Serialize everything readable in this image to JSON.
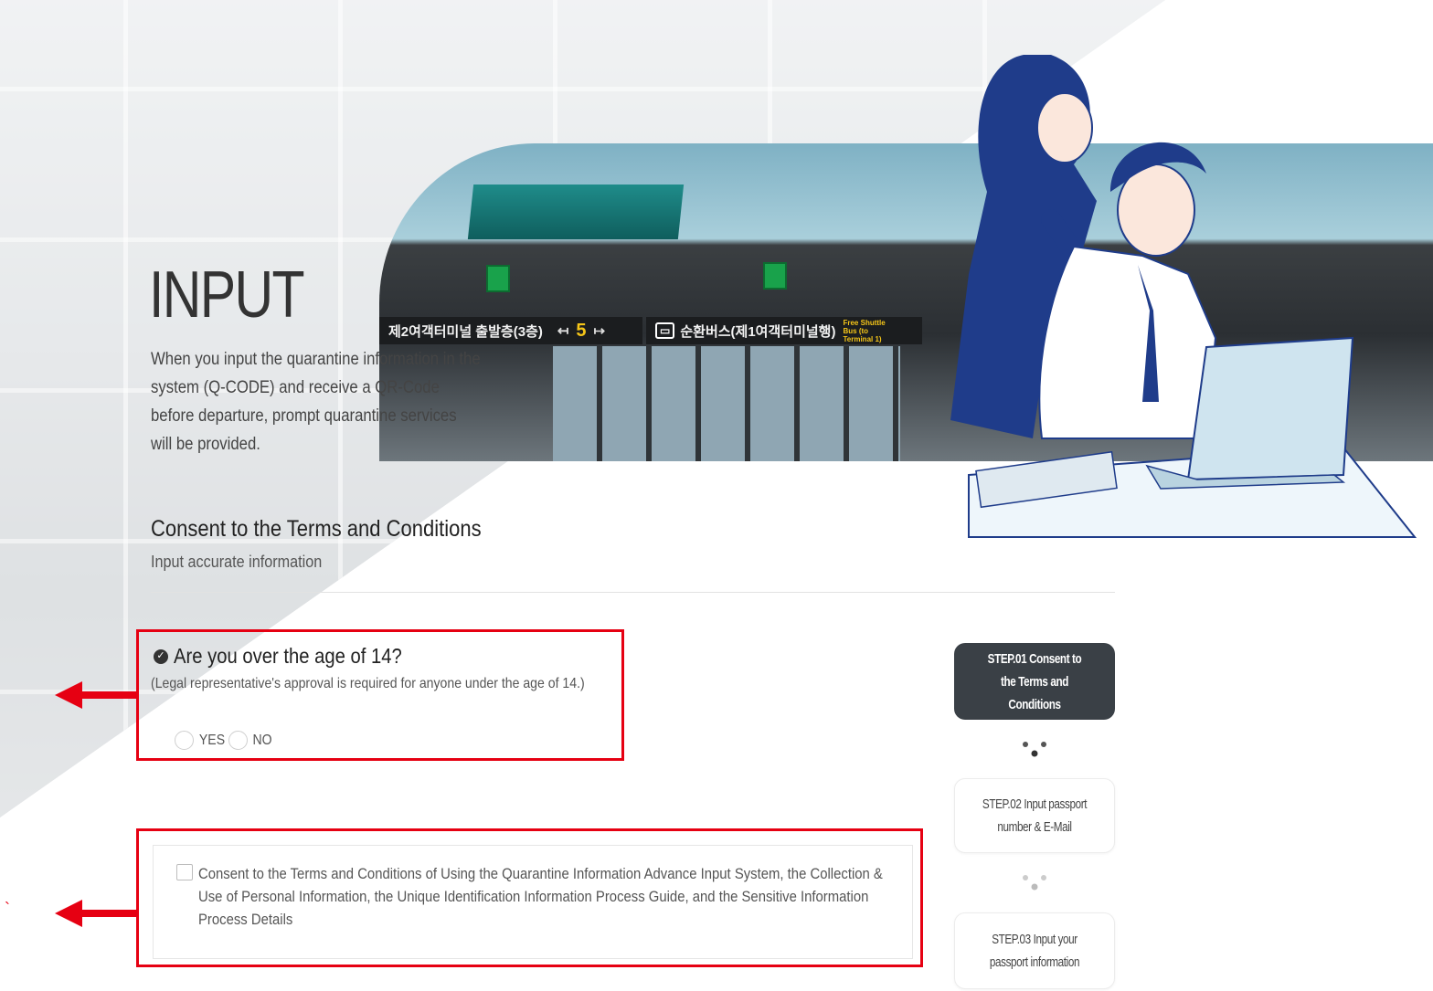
{
  "hero": {
    "title": "INPUT",
    "description": "When you input the quarantine information in the system (Q-CODE) and receive a QR-Code before departure, prompt quarantine services will be provided."
  },
  "banner": {
    "sign_korean": "제2여객터미널 출발층(3층)",
    "sign_gate": "5",
    "sign_bus": "순환버스(제1여객터미널행)",
    "sign_shuttle": "Free Shuttle Bus (to Terminal 1)"
  },
  "section": {
    "title": "Consent to the Terms and Conditions",
    "subtitle": "Input accurate information"
  },
  "age_question": {
    "title": "Are you over the age of 14?",
    "note": "(Legal representative's approval is required for anyone under the age of 14.)",
    "options": [
      "YES",
      "NO"
    ]
  },
  "consent": {
    "text": "Consent to the Terms and Conditions of Using the Quarantine Information Advance Input System, the Collection & Use of Personal Information, the Unique Identification Information Process Guide, and the Sensitive Information Process Details"
  },
  "steps": [
    {
      "label": "STEP.01 Consent to the Terms and Conditions",
      "active": true
    },
    {
      "label": "STEP.02 Input passport number & E-Mail",
      "active": false
    },
    {
      "label": "STEP.03 Input your passport information",
      "active": false
    }
  ],
  "colors": {
    "highlight": "#e60012",
    "active_step": "#3a4046",
    "navy": "#1f3c8a"
  }
}
